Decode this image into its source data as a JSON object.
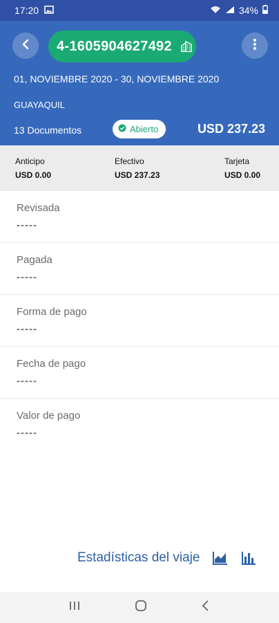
{
  "status_bar": {
    "time": "17:20",
    "battery": "34%"
  },
  "header": {
    "trip_code": "4-1605904627492",
    "date_range": "01, NOVIEMBRE 2020 - 30, NOVIEMBRE 2020",
    "city": "GUAYAQUIL",
    "documents": "13 Documentos",
    "status": "Abierto",
    "total": "USD 237.23"
  },
  "summary": [
    {
      "label": "Anticipo",
      "value": "USD 0.00"
    },
    {
      "label": "Efectivo",
      "value": "USD 237.23"
    },
    {
      "label": "Tarjeta",
      "value": "USD 0.00"
    }
  ],
  "fields": [
    {
      "label": "Revisada",
      "value": "-----"
    },
    {
      "label": "Pagada",
      "value": "-----"
    },
    {
      "label": "Forma de pago",
      "value": "-----"
    },
    {
      "label": "Fecha de pago",
      "value": "-----"
    },
    {
      "label": "Valor de pago",
      "value": "-----"
    }
  ],
  "footer": {
    "stats_label": "Estadísticas del viaje"
  },
  "colors": {
    "header": "#3669bc",
    "status_bar": "#2f50a5",
    "accent_green": "#1aaa74",
    "link_blue": "#2b5fa8"
  },
  "icons": [
    "image-icon",
    "wifi-icon",
    "signal-icon",
    "battery-icon",
    "back-icon",
    "building-icon",
    "more-icon",
    "check-circle-icon",
    "line-chart-icon",
    "bar-chart-icon",
    "recents-icon",
    "home-icon",
    "nav-back-icon"
  ]
}
